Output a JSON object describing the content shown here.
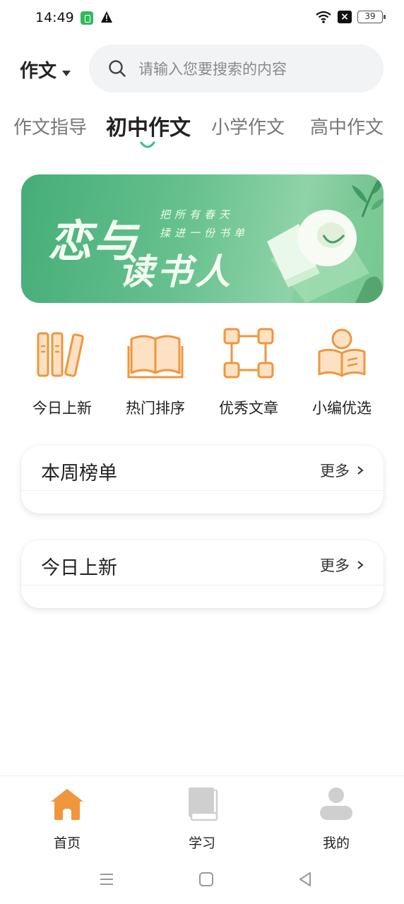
{
  "status_bar": {
    "time": "14:49",
    "battery": "39"
  },
  "header": {
    "category": "作文",
    "search_placeholder": "请输入您要搜索的内容"
  },
  "tabs": [
    {
      "label": "作文指导",
      "active": false
    },
    {
      "label": "初中作文",
      "active": true
    },
    {
      "label": "小学作文",
      "active": false
    },
    {
      "label": "高中作文",
      "active": false
    }
  ],
  "banner": {
    "title_line1": "恋与",
    "title_line2": "读书人",
    "subtitle_line1": "把所有春天",
    "subtitle_line2": "揉进一份书单"
  },
  "quick_actions": [
    {
      "label": "今日上新",
      "icon": "books-icon"
    },
    {
      "label": "热门排序",
      "icon": "open-book-icon"
    },
    {
      "label": "优秀文章",
      "icon": "nodes-icon"
    },
    {
      "label": "小编优选",
      "icon": "reader-icon"
    }
  ],
  "cards": [
    {
      "title": "本周榜单",
      "more": "更多"
    },
    {
      "title": "今日上新",
      "more": "更多"
    }
  ],
  "bottom_nav": [
    {
      "label": "首页",
      "icon": "home-icon",
      "active": true
    },
    {
      "label": "学习",
      "icon": "book-icon",
      "active": false
    },
    {
      "label": "我的",
      "icon": "user-icon",
      "active": false
    }
  ],
  "colors": {
    "accent": "#f0963c",
    "tab_indicator": "#3dbf9a",
    "banner_green": "#5cba85",
    "inactive_icon": "#c9c9c9"
  }
}
